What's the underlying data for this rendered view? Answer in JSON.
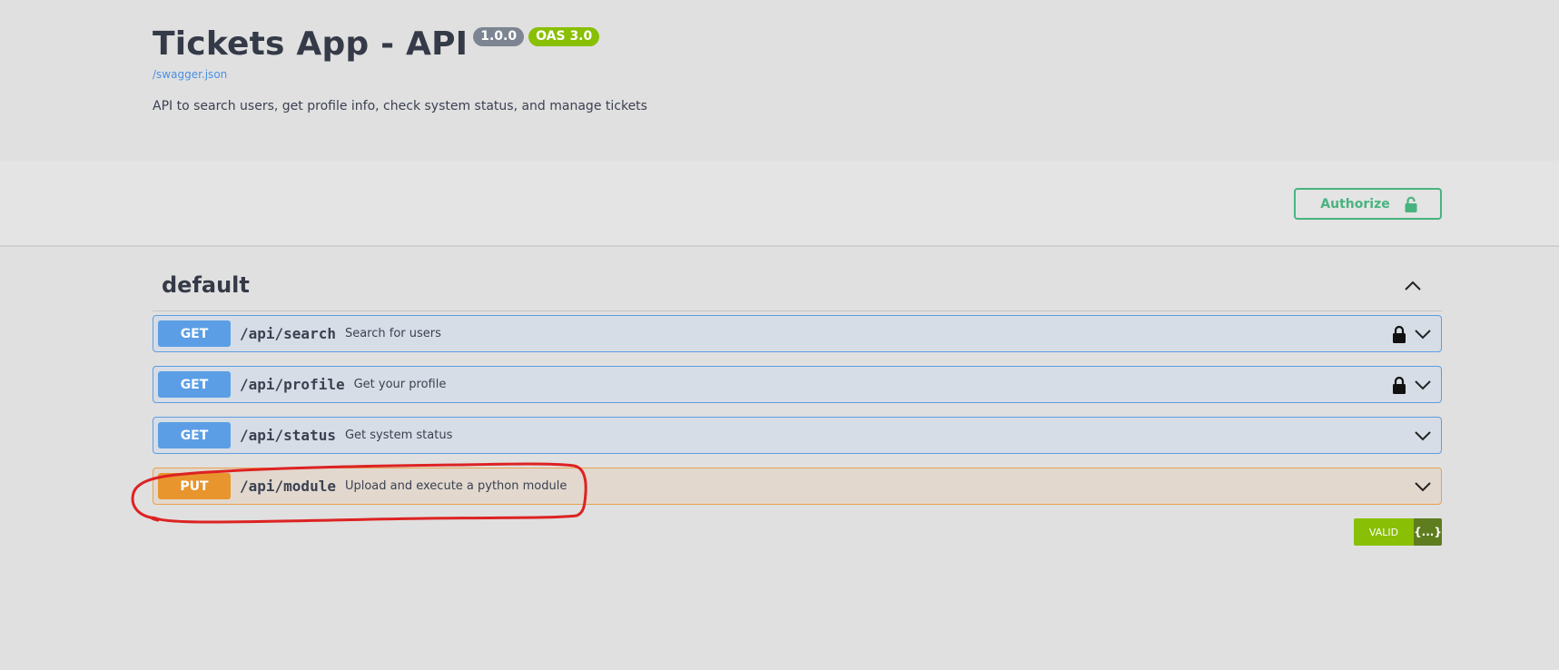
{
  "info": {
    "title": "Tickets App - API",
    "version": "1.0.0",
    "oas": "OAS 3.0",
    "spec_url": "/swagger.json",
    "description": "API to search users, get profile info, check system status, and manage tickets"
  },
  "authorize": {
    "label": "Authorize"
  },
  "section": {
    "title": "default"
  },
  "operations": [
    {
      "method": "GET",
      "path": "/api/search",
      "summary": "Search for users",
      "locked": true
    },
    {
      "method": "GET",
      "path": "/api/profile",
      "summary": "Get your profile",
      "locked": true
    },
    {
      "method": "GET",
      "path": "/api/status",
      "summary": "Get system status",
      "locked": false
    },
    {
      "method": "PUT",
      "path": "/api/module",
      "summary": "Upload and execute a python module",
      "locked": false
    }
  ],
  "validator": {
    "label": "VALID",
    "json_label": "{...}"
  },
  "colors": {
    "get": "#5b9ee5",
    "put": "#e8952d",
    "authorize": "#49b37f",
    "version_badge": "#7d8492",
    "oas_badge": "#89bf04",
    "annotation": "#dd2222"
  }
}
